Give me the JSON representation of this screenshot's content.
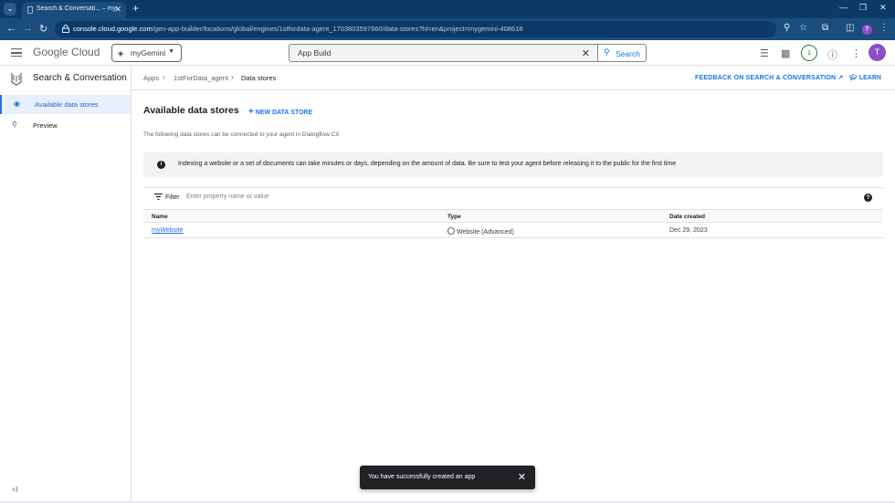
{
  "browser": {
    "tab_title": "Search & Conversati... – myGemi",
    "new_tab": "+",
    "url_host": "console.cloud.google.com",
    "url_path": "/gen-app-builder/locations/global/engines/1stfordata-agent_1703803597660/data-stores?hl=en&project=mygemini-408618"
  },
  "header": {
    "logo_google": "Google",
    "logo_cloud": "Cloud",
    "project": "myGemini",
    "search_value": "App Build",
    "search_button": "Search",
    "notifications": "1",
    "user_initial": "T"
  },
  "sidebar": {
    "product": "Search & Conversation",
    "items": [
      {
        "label": "Available data stores",
        "icon": "datastore-icon"
      },
      {
        "label": "Preview",
        "icon": "search-icon"
      }
    ],
    "collapse": "<I"
  },
  "breadcrumb": {
    "items": [
      "Apps",
      "1stForData_agent",
      "Data stores"
    ]
  },
  "actions": {
    "feedback": "FEEDBACK ON SEARCH & CONVERSATION",
    "learn": "LEARN"
  },
  "page": {
    "title": "Available data stores",
    "new_button": "NEW DATA STORE",
    "description": "The following data stores can be connected to your agent in Dialogflow CX",
    "info": "Indexing a website or a set of documents can take minutes or days, depending on the amount of data. Be sure to test your agent before releasing it to the public for the first time"
  },
  "filter": {
    "label": "Filter",
    "placeholder": "Enter property name or value"
  },
  "table": {
    "headers": [
      "Name",
      "Type",
      "Date created"
    ],
    "rows": [
      {
        "name": "myWebsite",
        "type": "Website (Advanced)",
        "date": "Dec 29, 2023"
      }
    ]
  },
  "toast": {
    "message": "You have successfully created an app"
  },
  "colors": {
    "accent": "#1a73e8",
    "browser_frame": "#1a4d7c",
    "avatar": "#8e4ec6"
  }
}
